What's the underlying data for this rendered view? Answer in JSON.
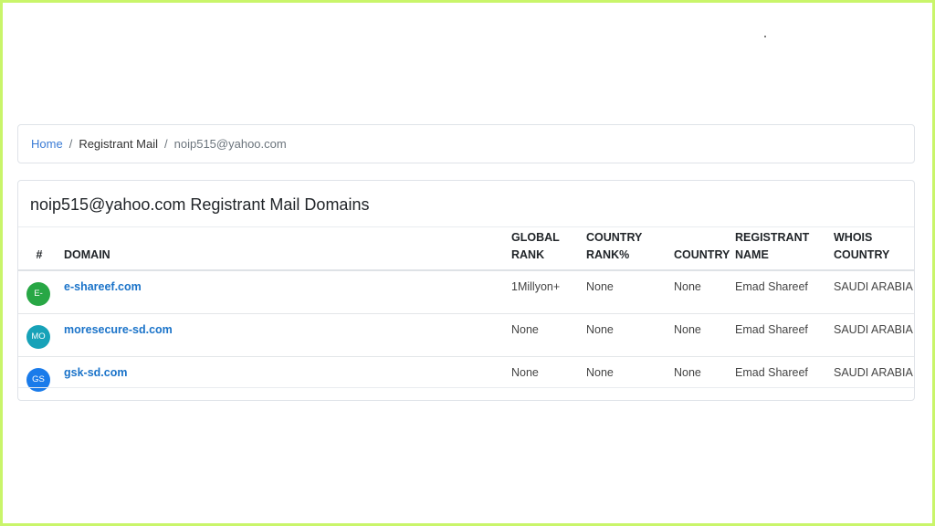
{
  "breadcrumb": {
    "home": "Home",
    "section": "Registrant Mail",
    "current": "noip515@yahoo.com",
    "separator": "/"
  },
  "card": {
    "title": "noip515@yahoo.com Registrant Mail Domains"
  },
  "table": {
    "headers": {
      "num": "#",
      "domain": "DOMAIN",
      "global_rank_1": "GLOBAL",
      "global_rank_2": "RANK",
      "country_rank_1": "COUNTRY",
      "country_rank_2": "RANK%",
      "country": "COUNTRY",
      "registrant_1": "REGISTRANT",
      "registrant_2": "NAME",
      "whois_1": "WHOIS",
      "whois_2": "COUNTRY"
    },
    "rows": [
      {
        "avatar": "E-",
        "avatar_color": "#28a745",
        "domain": "e-shareef.com",
        "global_rank": "1Millyon+",
        "country_rank": "None",
        "country": "None",
        "registrant": "Emad Shareef",
        "whois_country": "SAUDI ARABIA"
      },
      {
        "avatar": "MO",
        "avatar_color": "#17a2b8",
        "domain": "moresecure-sd.com",
        "global_rank": "None",
        "country_rank": "None",
        "country": "None",
        "registrant": "Emad Shareef",
        "whois_country": "SAUDI ARABIA"
      },
      {
        "avatar": "GS",
        "avatar_color": "#1a7bea",
        "domain": "gsk-sd.com",
        "global_rank": "None",
        "country_rank": "None",
        "country": "None",
        "registrant": "Emad Shareef",
        "whois_country": "SAUDI ARABIA"
      }
    ]
  },
  "colors": {
    "frame_border": "#c9f56a",
    "link": "#1a73c9"
  }
}
